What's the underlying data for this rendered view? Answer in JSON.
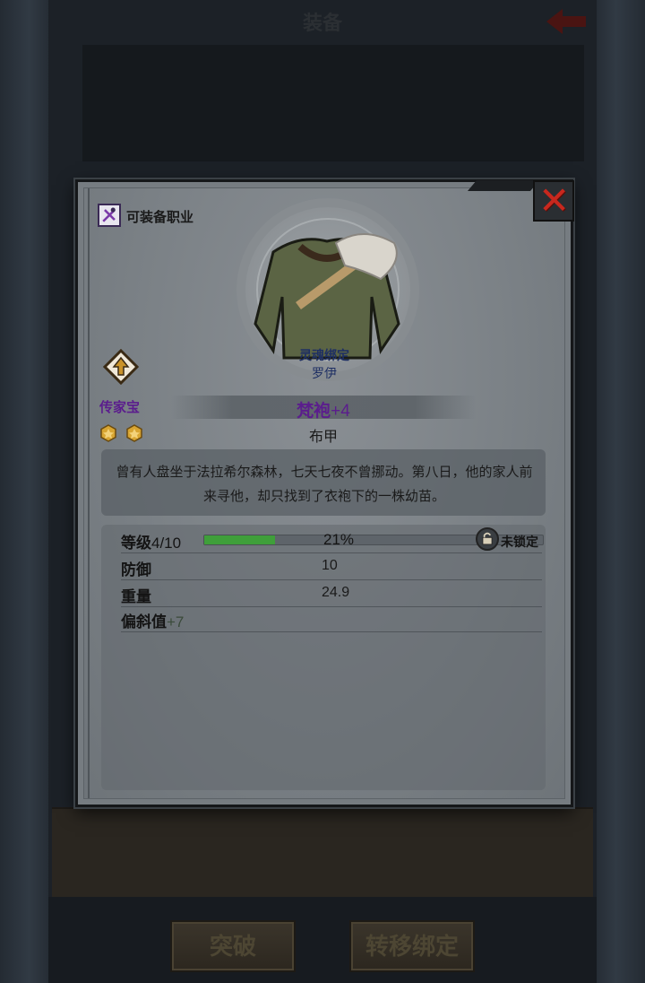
{
  "background": {
    "title": "装备",
    "buttons": {
      "break": "突破",
      "transfer": "转移绑定"
    }
  },
  "popup": {
    "class_label": "可装备职业",
    "soulbound": "灵魂绑定",
    "owner": "罗伊",
    "rarity_label": "传家宝",
    "stars": 2,
    "item_name": "梵袍",
    "item_plus": "+4",
    "item_type": "布甲",
    "description": "曾有人盘坐于法拉希尔森林，七天七夜不曾挪动。第八日，他的家人前来寻他，却只找到了衣袍下的一株幼苗。",
    "level": {
      "label": "等级",
      "value": "4/10",
      "progress_percent": 21,
      "progress_text": "21%",
      "lock_status": "未锁定"
    },
    "stats": [
      {
        "label": "防御",
        "value": "10"
      },
      {
        "label": "重量",
        "value": "24.9"
      }
    ],
    "bias": {
      "label": "偏斜值",
      "value": "+7"
    }
  },
  "colors": {
    "rarity_purple": "#5b1d8d",
    "progress_green": "#3f9f3a",
    "close_red": "#c8281e"
  },
  "icons": [
    "class-icon",
    "heirloom-icon",
    "star-icon",
    "lock-icon",
    "close-icon",
    "back-arrow-icon"
  ]
}
